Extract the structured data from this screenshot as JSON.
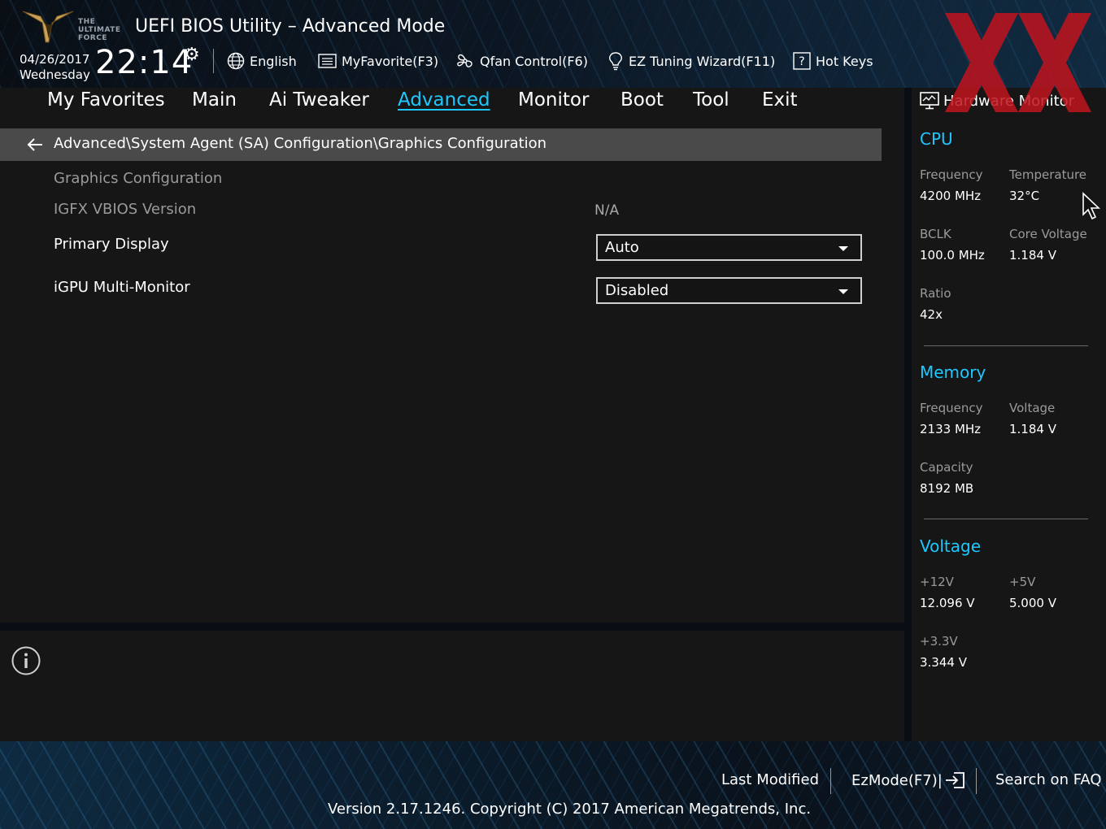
{
  "header": {
    "logo_text": [
      "THE",
      "ULTIMATE",
      "FORCE"
    ],
    "title": "UEFI BIOS Utility – Advanced Mode",
    "date": "04/26/2017",
    "weekday": "Wednesday",
    "time": "22:14",
    "tools": {
      "language": "English",
      "my_favorite": "MyFavorite(F3)",
      "qfan": "Qfan Control(F6)",
      "ez_tuning": "EZ Tuning Wizard(F11)",
      "hot_keys": "Hot Keys"
    }
  },
  "tabs": {
    "my_favorites": "My Favorites",
    "main": "Main",
    "ai_tweaker": "Ai Tweaker",
    "advanced": "Advanced",
    "monitor": "Monitor",
    "boot": "Boot",
    "tool": "Tool",
    "exit": "Exit",
    "active": "Advanced"
  },
  "breadcrumb": "Advanced\\System Agent (SA) Configuration\\Graphics Configuration",
  "settings": {
    "section_title": "Graphics Configuration",
    "igfx_label": "IGFX VBIOS Version",
    "igfx_value": "N/A",
    "primary_display_label": "Primary Display",
    "primary_display_value": "Auto",
    "igpu_multi_label": "iGPU Multi-Monitor",
    "igpu_multi_value": "Disabled"
  },
  "hw_monitor": {
    "title": "Hardware Monitor",
    "cpu": {
      "heading": "CPU",
      "frequency_label": "Frequency",
      "frequency_value": "4200 MHz",
      "temperature_label": "Temperature",
      "temperature_value": "32°C",
      "bclk_label": "BCLK",
      "bclk_value": "100.0 MHz",
      "core_voltage_label": "Core Voltage",
      "core_voltage_value": "1.184 V",
      "ratio_label": "Ratio",
      "ratio_value": "42x"
    },
    "memory": {
      "heading": "Memory",
      "frequency_label": "Frequency",
      "frequency_value": "2133 MHz",
      "voltage_label": "Voltage",
      "voltage_value": "1.184 V",
      "capacity_label": "Capacity",
      "capacity_value": "8192 MB"
    },
    "voltage": {
      "heading": "Voltage",
      "v12_label": "+12V",
      "v12_value": "12.096 V",
      "v5_label": "+5V",
      "v5_value": "5.000 V",
      "v33_label": "+3.3V",
      "v33_value": "3.344 V"
    }
  },
  "footer": {
    "last_modified": "Last Modified",
    "ez_mode": "EzMode(F7)|",
    "search_faq": "Search on FAQ",
    "version": "Version 2.17.1246. Copyright (C) 2017 American Megatrends, Inc."
  },
  "colors": {
    "accent": "#1ec8ff",
    "panel": "#161616",
    "breadcrumb_bg": "#4a4a4a",
    "watermark": "#c0141e"
  },
  "icons": {
    "logo": "tuf-eagle-logo",
    "clock_settings": "gear-icon",
    "language": "globe-icon",
    "favorite": "list-icon",
    "qfan": "fan-icon",
    "ez_tuning": "lightbulb-icon",
    "hot_keys": "question-box-icon",
    "back": "arrow-left-icon",
    "info": "info-icon",
    "hw_monitor": "monitor-icon",
    "ez_mode": "exit-arrow-icon",
    "watermark": "xx-watermark-icon",
    "cursor": "mouse-pointer-icon"
  }
}
